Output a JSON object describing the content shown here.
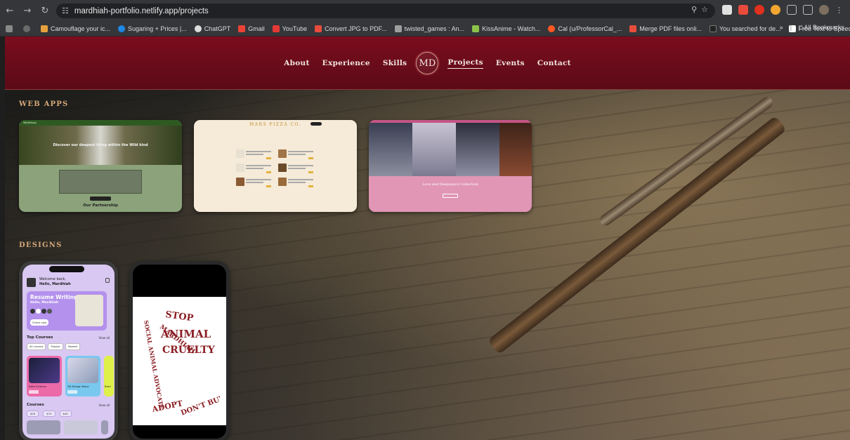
{
  "browser": {
    "url": "mardhiah-portfolio.netlify.app/projects",
    "bookmarks": [
      "Camouflage your ic...",
      "Sugaring + Prices |...",
      "ChatGPT",
      "Gmail",
      "YouTube",
      "Convert JPG to PDF...",
      "twisted_games : An...",
      "KissAnime - Watch...",
      "Cal (u/ProfessorCal_...",
      "Merge PDF files onli...",
      "You searched for de...",
      "Free Text to Speech..."
    ],
    "more_bookmarks": "»",
    "all_bookmarks": "All Bookmarks"
  },
  "nav": {
    "about": "About",
    "experience": "Experience",
    "skills": "Skills",
    "logo": "MD",
    "projects": "Projects",
    "events": "Events",
    "contact": "Contact"
  },
  "sections": {
    "web_apps": "WEB APPS",
    "designs": "DESIGNS"
  },
  "web_apps": {
    "app1": {
      "nav_brand": "Wildlifeorg",
      "hero_text": "Discover our deepest thing within the Wild kind",
      "caption": "Our Partnership"
    },
    "app2": {
      "title": "MARS PIZZA CO."
    },
    "app3": {
      "title": "Love and Deepspace Collection"
    }
  },
  "design1": {
    "welcome": "Welcome back,",
    "user": "Hello, Mardhiah",
    "card_title": "Resume Writing",
    "card_sub": "Hello, Mardhiah",
    "check_now": "Check now",
    "top_courses": "Top Courses",
    "view_all": "View all",
    "chips": [
      "All courses",
      "Popular",
      "Newest"
    ],
    "tile1": "Data Science",
    "tile2": "3D Design Basic",
    "tile3": "Bran",
    "courses": "Courses",
    "view_all_2": "View all",
    "stats": [
      "$20",
      "$70",
      "$40"
    ]
  },
  "design2": {
    "lines": [
      "STOP",
      "ANIMAL",
      "CRUELTY",
      "SOCIAL ANIMAL ADVOCATE",
      "MARDHIAH",
      "ADOPT",
      "DON'T BUY"
    ]
  },
  "colors": {
    "header": "#6b0b1b",
    "section_title": "#d4a77a",
    "nav_text": "#f1e6df"
  }
}
